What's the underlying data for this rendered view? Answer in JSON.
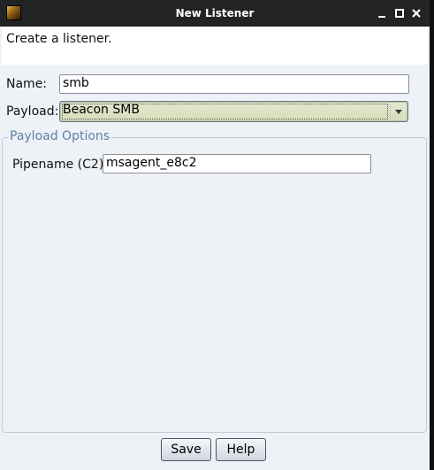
{
  "window": {
    "title": "New Listener"
  },
  "header": {
    "text": "Create a listener."
  },
  "form": {
    "name_label": "Name:",
    "name_value": "smb",
    "payload_label": "Payload:",
    "payload_value": "Beacon SMB"
  },
  "payload_options": {
    "title": "Payload Options",
    "pipename_label": "Pipename (C2):",
    "pipename_value": "msagent_e8c2"
  },
  "buttons": {
    "save": "Save",
    "help": "Help"
  },
  "colors": {
    "titlebar": "#222325",
    "window_bg": "#eef2f7",
    "group_title": "#5e7fa9",
    "select_bg": "#d6ddb8"
  }
}
